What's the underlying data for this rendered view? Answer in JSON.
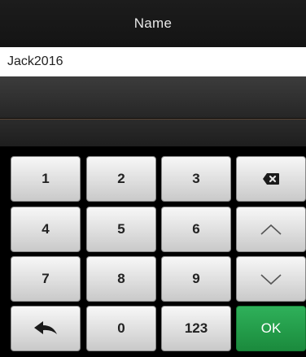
{
  "header": {
    "title": "Name"
  },
  "input": {
    "value": "Jack2016"
  },
  "keypad": {
    "keys": {
      "k1": "1",
      "k2": "2",
      "k3": "3",
      "k4": "4",
      "k5": "5",
      "k6": "6",
      "k7": "7",
      "k8": "8",
      "k9": "9",
      "k0": "0",
      "mode": "123",
      "ok": "OK"
    },
    "icons": {
      "backspace": "backspace-icon",
      "up": "chevron-up-icon",
      "down": "chevron-down-icon",
      "back": "back-arrow-icon"
    }
  },
  "colors": {
    "ok_key": "#229a48",
    "key_face": "#e0e0e0",
    "title_bar": "#181818"
  }
}
